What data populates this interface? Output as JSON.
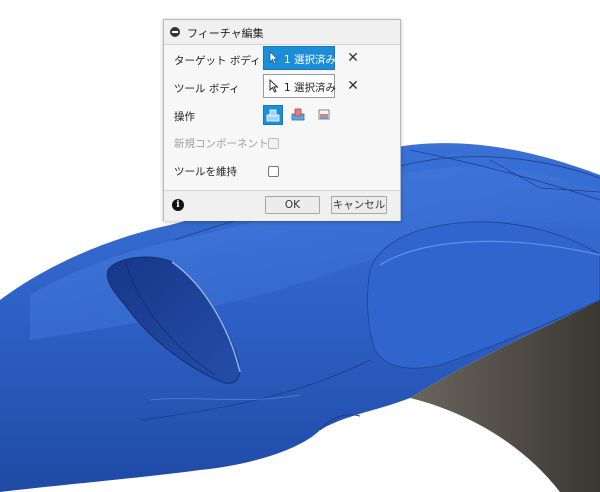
{
  "dialog": {
    "title": "フィーチャ編集",
    "rows": {
      "target_body": {
        "label": "ターゲット ボディ",
        "selection": "1 選択済み",
        "clear": "✕"
      },
      "tool_body": {
        "label": "ツール ボディ",
        "selection": "1 選択済み",
        "clear": "✕"
      },
      "operation": {
        "label": "操作",
        "options": [
          "join-icon",
          "cut-icon",
          "intersect-icon"
        ],
        "selected": "join-icon"
      },
      "new_component": {
        "label": "新規コンポーネント",
        "checked": false,
        "enabled": false
      },
      "keep_tools": {
        "label": "ツールを維持",
        "checked": false,
        "enabled": true
      }
    },
    "info": "i",
    "ok_label": "OK",
    "cancel_label": "キャンセル"
  },
  "colors": {
    "body_blue": "#2f63c8",
    "accent": "#1a8ed8",
    "tool_body": "#4a4640"
  }
}
